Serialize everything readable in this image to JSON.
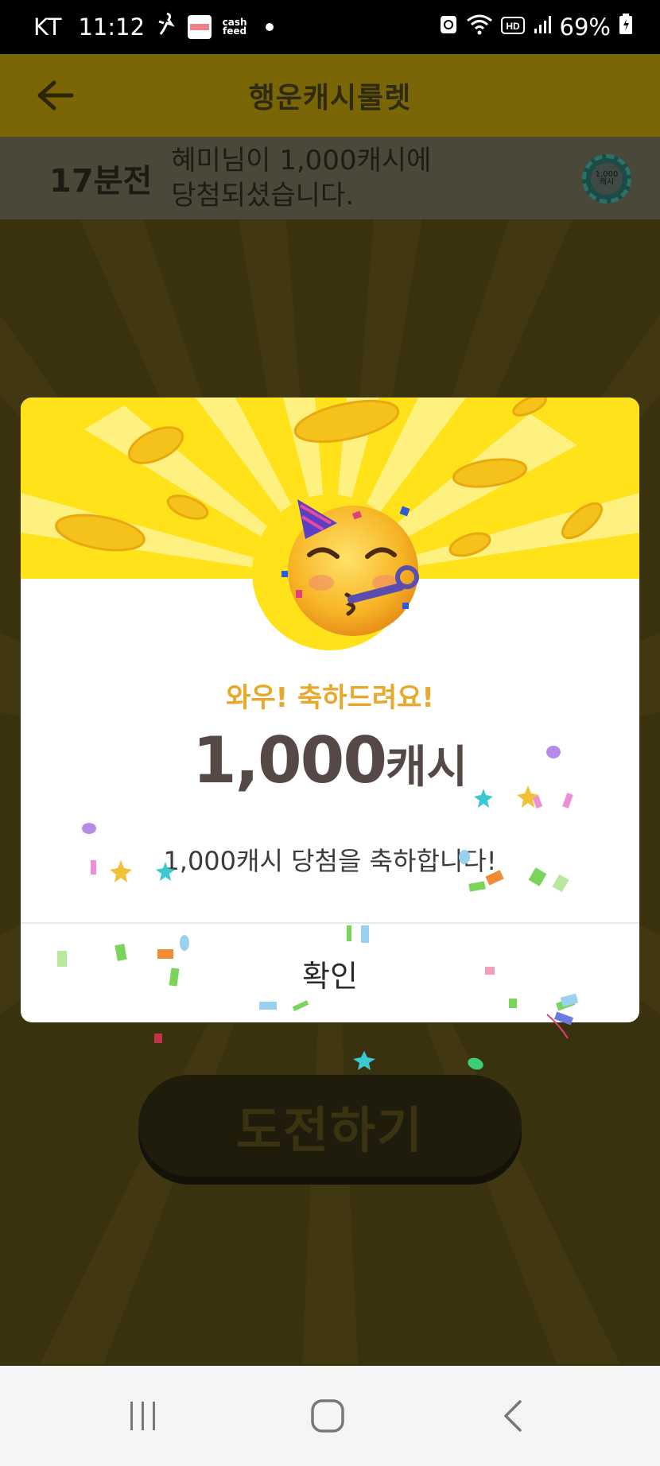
{
  "status_bar": {
    "carrier": "KT",
    "time": "11:12",
    "app_icon_1": "lotte-icon",
    "app_icon_2_text": "cash feed",
    "battery": "69%"
  },
  "header": {
    "title": "행운캐시룰렛",
    "back_icon": "arrow-left-icon"
  },
  "ticker": {
    "time_ago": "17분전",
    "message_line1": "혜미님이 1,000캐시에",
    "message_line2": "당첨되셨습니다.",
    "chip_text": "1,000 캐시"
  },
  "modal": {
    "subtitle": "와우! 축하드려요!",
    "amount_value": "1,000",
    "amount_unit": "캐시",
    "message": "1,000캐시 당첨을 축하합니다!",
    "confirm_label": "확인"
  },
  "main": {
    "challenge_label": "도전하기"
  },
  "colors": {
    "accent_yellow": "#ffe21a",
    "subtitle_orange": "#e8a82a",
    "amount_text": "#574848"
  }
}
